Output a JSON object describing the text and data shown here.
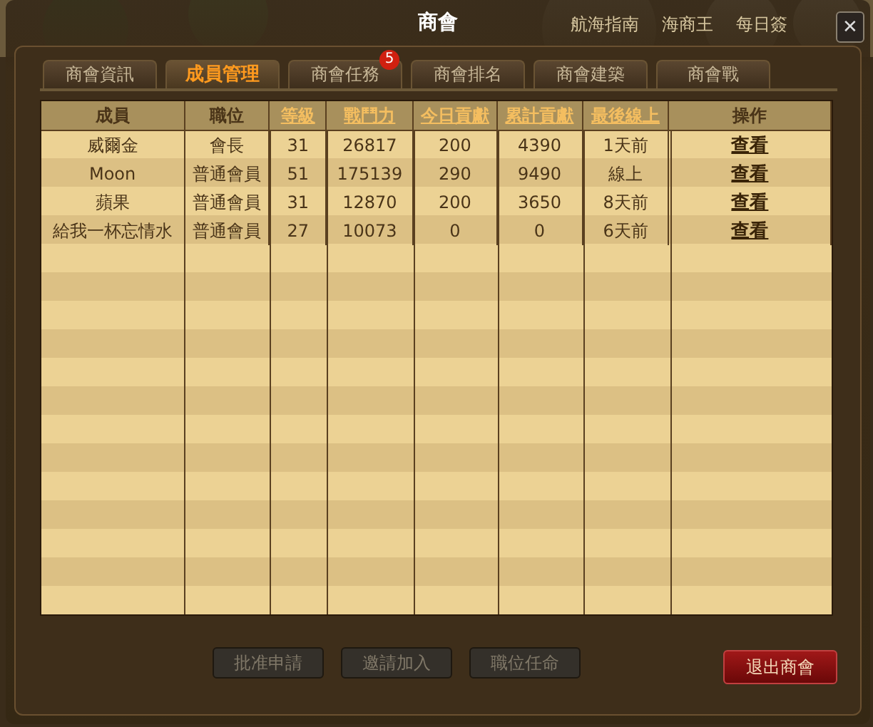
{
  "background_labels": [
    "航海指南",
    "海商王",
    "每日簽"
  ],
  "window": {
    "title": "商會",
    "close": "✕"
  },
  "tabs": [
    {
      "label": "商會資訊",
      "selected": false
    },
    {
      "label": "成員管理",
      "selected": true
    },
    {
      "label": "商會任務",
      "selected": false,
      "badge": "5"
    },
    {
      "label": "商會排名",
      "selected": false
    },
    {
      "label": "商會建築",
      "selected": false
    },
    {
      "label": "商會戰",
      "selected": false
    }
  ],
  "table": {
    "columns": [
      {
        "label": "成員",
        "sortable": false
      },
      {
        "label": "職位",
        "sortable": false
      },
      {
        "label": "等級",
        "sortable": true
      },
      {
        "label": "戰鬥力",
        "sortable": true
      },
      {
        "label": "今日貢獻",
        "sortable": true
      },
      {
        "label": "累計貢獻",
        "sortable": true
      },
      {
        "label": "最後線上",
        "sortable": true
      },
      {
        "label": "操作",
        "sortable": false
      }
    ],
    "rows": [
      {
        "cells": [
          "威爾金",
          "會長",
          "31",
          "26817",
          "200",
          "4390",
          "1天前"
        ],
        "action": "查看"
      },
      {
        "cells": [
          "Moon",
          "普通會員",
          "51",
          "175139",
          "290",
          "9490",
          "線上"
        ],
        "action": "查看"
      },
      {
        "cells": [
          "蘋果",
          "普通會員",
          "31",
          "12870",
          "200",
          "3650",
          "8天前"
        ],
        "action": "查看"
      },
      {
        "cells": [
          "給我一杯忘情水",
          "普通會員",
          "27",
          "10073",
          "0",
          "0",
          "6天前"
        ],
        "action": "查看"
      }
    ]
  },
  "buttons": [
    {
      "label": "批准申請",
      "disabled": true
    },
    {
      "label": "邀請加入",
      "disabled": true
    },
    {
      "label": "職位任命",
      "disabled": true
    }
  ],
  "exit_button": {
    "label": "退出商會",
    "disabled": false
  }
}
